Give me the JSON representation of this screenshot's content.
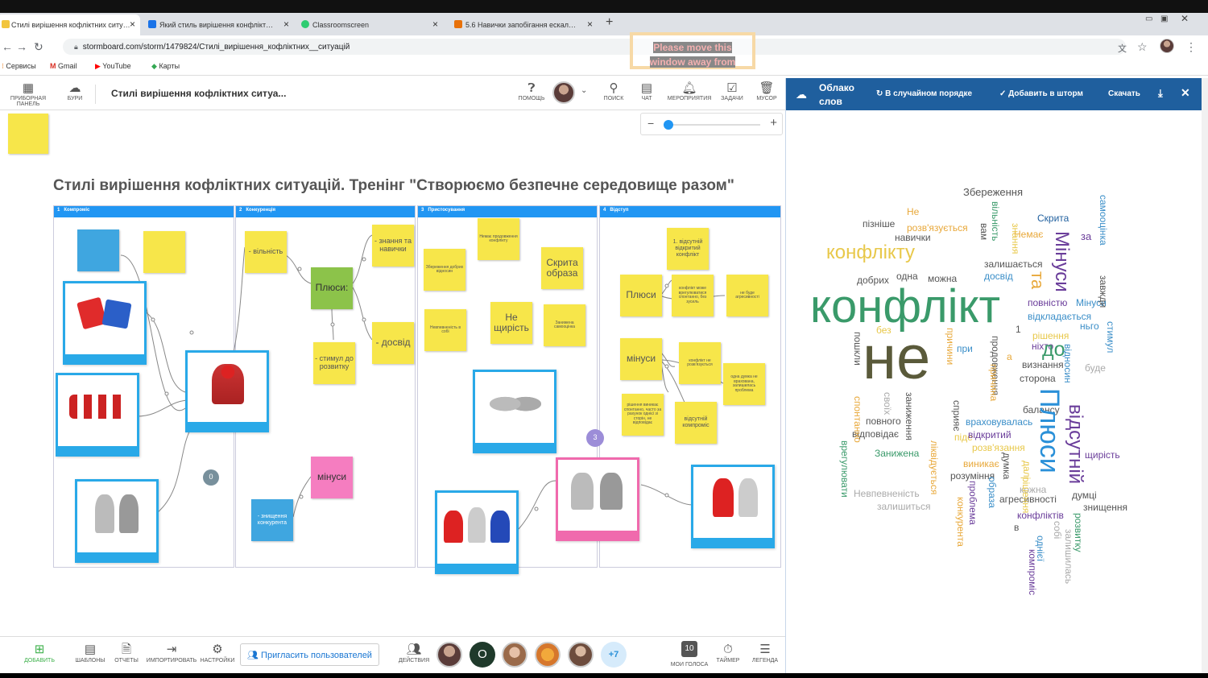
{
  "browser": {
    "tabs": [
      {
        "label": "Стилі вирішення кофліктних ситу…",
        "color": "#f2c53d",
        "active": true
      },
      {
        "label": "Який стиль вирішення конфлікт…",
        "color": "#1a73e8",
        "active": false
      },
      {
        "label": "Classroomscreen",
        "color": "#2ecc71",
        "active": false
      },
      {
        "label": "5.6 Навички запобігання ескал…",
        "color": "#e8710a",
        "active": false
      }
    ],
    "url": "stormboard.com/storm/1479824/Стилі_вирішення_кофліктних__ситуацій",
    "bookmarks": [
      "Сервисы",
      "Gmail",
      "YouTube",
      "Карты"
    ],
    "overlay_note": "Please move this window away from"
  },
  "app": {
    "dashboard_label": "ПРИБОРНАЯ ПАНЕЛЬ",
    "storms_label": "БУРИ",
    "storm_title": "Стилі вирішення кофліктних ситуа...",
    "header_buttons": {
      "help": "ПОМОЩЬ",
      "search": "ПОИСК",
      "chat": "ЧАТ",
      "events": "МЕРОПРИЯТИЯ",
      "tasks": "ЗАДАЧИ",
      "trash": "МУСОР"
    }
  },
  "board": {
    "title": "Стилі вирішення кофліктних ситуацій. Тренінг \"Створюємо безпечне середовище разом\"",
    "columns": [
      {
        "num": "1",
        "name": "Компроміс",
        "color": "#2196f3"
      },
      {
        "num": "2",
        "name": "Конкуренція",
        "color": "#2196f3"
      },
      {
        "num": "3",
        "name": "Пристосування",
        "color": "#2196f3"
      },
      {
        "num": "4",
        "name": "Відступ",
        "color": "#2196f3"
      }
    ],
    "stickies": {
      "c1_blue": "",
      "c1_yellow": "",
      "c2_a": "- вільність",
      "c2_b": "- знання та навички",
      "c2_plusy": "Плюси:",
      "c2_c": "- стимул до розвитку",
      "c2_d": "- досвід",
      "c2_minusy": "мінуси",
      "c2_e": "- знищення конкурента",
      "c3_a": "Немає продовження конфлікту",
      "c3_b": "Збереження добрих відносин",
      "c3_c": "Скрита образа",
      "c3_d": "Невпевненість в собі",
      "c3_e": "Не щирість",
      "c3_f": "Занижена самооцінка",
      "c4_a": "1. відсутній відкритий конфлікт",
      "c4_plusy": "Плюси",
      "c4_b": "конфлікт може врегулюватися спонтанно, без зусиль",
      "c4_c": "не буде агресивності",
      "c4_minusy": "мінуси",
      "c4_d": "конфлікт не розв'язується",
      "c4_e": "одна думка не врахована, залишилась проблема",
      "c4_f": "рішення виникає спонтанно, часто за рахунок однієї зі сторін, не відповідає",
      "c4_g": "відсутній компроміс"
    },
    "markers": {
      "m1": "0",
      "m2": "3"
    }
  },
  "bottom": {
    "add": "ДОБАВИТЬ",
    "templates": "ШАБЛОНЫ",
    "reports": "ОТЧЕТЫ",
    "import": "ИМПОРТИРОВАТЬ",
    "settings": "НАСТРОЙКИ",
    "invite": "Пригласить пользователей",
    "actions": "ДЕЙСТВИЯ",
    "more_users": "+7",
    "user_letter": "O",
    "votes_count": "10",
    "my_votes": "МОИ ГОЛОСА",
    "timer": "ТАЙМЕР",
    "legend": "ЛЕГЕНДА"
  },
  "panel": {
    "title_line1": "Облако",
    "title_line2": "слов",
    "shuffle": "В случайном порядке",
    "add_to_storm": "Добавить в шторм",
    "download": "Скачать",
    "words": [
      {
        "t": "Збереження",
        "c": "#555"
      },
      {
        "t": "Не",
        "c": "#e8a83a"
      },
      {
        "t": "пізніше",
        "c": "#555"
      },
      {
        "t": "розв'язується",
        "c": "#e8a83a"
      },
      {
        "t": "Скрита",
        "c": "#1f5f9e"
      },
      {
        "t": "Немає",
        "c": "#e8a83a"
      },
      {
        "t": "за",
        "c": "#6a3d9a"
      },
      {
        "t": "навички",
        "c": "#555"
      },
      {
        "t": "конфлікту",
        "c": "#e8c84a"
      },
      {
        "t": "залишається",
        "c": "#555"
      },
      {
        "t": "досвід",
        "c": "#3a8ec8"
      },
      {
        "t": "добрих",
        "c": "#555"
      },
      {
        "t": "одна",
        "c": "#555"
      },
      {
        "t": "можна",
        "c": "#555"
      },
      {
        "t": "конфлікт",
        "c": "#3a9a6a"
      },
      {
        "t": "не",
        "c": "#5a5a3a"
      },
      {
        "t": "повністю",
        "c": "#6a3d9a"
      },
      {
        "t": "Мінуси",
        "c": "#3a8ec8"
      },
      {
        "t": "відкладається",
        "c": "#3a8ec8"
      },
      {
        "t": "ньго",
        "c": "#3a8ec8"
      },
      {
        "t": "рішення",
        "c": "#e8c84a"
      },
      {
        "t": "без",
        "c": "#e8c84a"
      },
      {
        "t": "при",
        "c": "#3a8ec8"
      },
      {
        "t": "ніхто",
        "c": "#6a3d9a"
      },
      {
        "t": "до",
        "c": "#3a9a6a"
      },
      {
        "t": "визнання",
        "c": "#555"
      },
      {
        "t": "сторона",
        "c": "#555"
      },
      {
        "t": "буде",
        "c": "#aaa"
      },
      {
        "t": "балансу",
        "c": "#555"
      },
      {
        "t": "повного",
        "c": "#555"
      },
      {
        "t": "враховувалась",
        "c": "#3a8ec8"
      },
      {
        "t": "відповідає",
        "c": "#555"
      },
      {
        "t": "піде",
        "c": "#e8c84a"
      },
      {
        "t": "відкритий",
        "c": "#6a3d9a"
      },
      {
        "t": "розв'язання",
        "c": "#e8c84a"
      },
      {
        "t": "щирість",
        "c": "#6a3d9a"
      },
      {
        "t": "Занижена",
        "c": "#3a9a6a"
      },
      {
        "t": "виникає",
        "c": "#e8a83a"
      },
      {
        "t": "розуміння",
        "c": "#555"
      },
      {
        "t": "кожна",
        "c": "#aaa"
      },
      {
        "t": "Невпевненість",
        "c": "#aaa"
      },
      {
        "t": "агресивності",
        "c": "#555"
      },
      {
        "t": "думці",
        "c": "#555"
      },
      {
        "t": "залишиться",
        "c": "#aaa"
      },
      {
        "t": "знищення",
        "c": "#555"
      },
      {
        "t": "конфліктів",
        "c": "#6a3d9a"
      },
      {
        "t": "в",
        "c": "#555"
      },
      {
        "t": "Плюси",
        "c": "#2a90d8"
      },
      {
        "t": "відсутній",
        "c": "#6a3d9a"
      },
      {
        "t": "Мінуси",
        "c": "#6a3d9a"
      },
      {
        "t": "та",
        "c": "#e8a83a"
      },
      {
        "t": "самооцінка",
        "c": "#3a8ec8"
      },
      {
        "t": "завжди",
        "c": "#555"
      },
      {
        "t": "стимул",
        "c": "#3a8ec8"
      },
      {
        "t": "відносин",
        "c": "#3a8ec8"
      },
      {
        "t": "вільність",
        "c": "#3a9a6a"
      },
      {
        "t": "пошкли",
        "c": "#555"
      },
      {
        "t": "спонтанно",
        "c": "#e8a83a"
      },
      {
        "t": "своїх",
        "c": "#aaa"
      },
      {
        "t": "заниження",
        "c": "#555"
      },
      {
        "t": "причини",
        "c": "#e8a83a"
      },
      {
        "t": "продовження",
        "c": "#555"
      },
      {
        "t": "сприяє",
        "c": "#555"
      },
      {
        "t": "ліквідується",
        "c": "#e8a83a"
      },
      {
        "t": "конкурента",
        "c": "#e8a83a"
      },
      {
        "t": "проблема",
        "c": "#6a3d9a"
      },
      {
        "t": "образа",
        "c": "#3a8ec8"
      },
      {
        "t": "компроміс",
        "c": "#6a3d9a"
      },
      {
        "t": "розвитку",
        "c": "#3a9a6a"
      },
      {
        "t": "врегулювати",
        "c": "#3a9a6a"
      },
      {
        "t": "залишилась",
        "c": "#aaa"
      },
      {
        "t": "однієї",
        "c": "#3a8ec8"
      },
      {
        "t": "знання",
        "c": "#e8c84a"
      },
      {
        "t": "рішення",
        "c": "#e8c84a"
      },
      {
        "t": "думка",
        "c": "#555"
      },
      {
        "t": "далі",
        "c": "#e8c84a"
      },
      {
        "t": "собі",
        "c": "#aaa"
      },
      {
        "t": "вам",
        "c": "#555"
      },
      {
        "t": "1",
        "c": "#555"
      },
      {
        "t": "а",
        "c": "#e8a83a"
      },
      {
        "t": "причина",
        "c": "#e8a83a"
      }
    ]
  }
}
